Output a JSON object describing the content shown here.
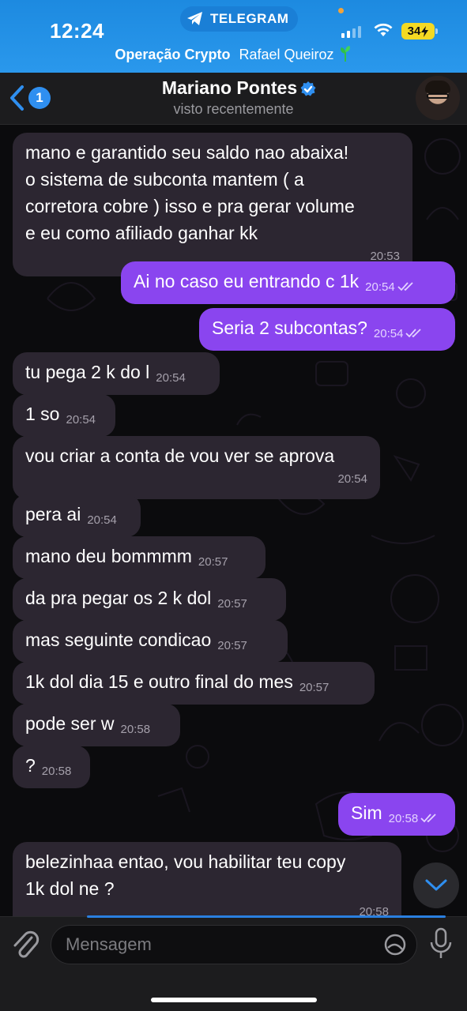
{
  "status_bar": {
    "time": "12:24",
    "app_pill_label": "TELEGRAM",
    "battery": "34",
    "battery_color": "#f4d923"
  },
  "chat_context": {
    "group": "Operação Crypto",
    "person": "Rafael Queiroz",
    "emoji_icon": "plant-icon"
  },
  "header": {
    "back_badge": "1",
    "contact_name": "Mariano Pontes",
    "verified_icon": "verified-badge-icon",
    "last_seen": "visto recentemente"
  },
  "messages": [
    {
      "dir": "in",
      "text": "mano e garantido seu saldo nao abaixa!\no sistema de subconta mantem ( a\ncorretora cobre ) isso e pra gerar volume\ne eu como afiliado ganhar kk",
      "time": "20:53"
    },
    {
      "dir": "out",
      "text": "Ai no caso eu entrando c 1k",
      "time": "20:54",
      "read": true
    },
    {
      "dir": "out",
      "text": "Seria 2 subcontas?",
      "time": "20:54",
      "read": true
    },
    {
      "dir": "in",
      "text": "tu pega 2 k do l",
      "time": "20:54"
    },
    {
      "dir": "in",
      "text": "1 so",
      "time": "20:54"
    },
    {
      "dir": "in",
      "text": "vou criar a conta de vou ver se aprova",
      "time": "20:54"
    },
    {
      "dir": "in",
      "text": "pera ai",
      "time": "20:54"
    },
    {
      "dir": "in",
      "text": "mano deu bommmm",
      "time": "20:57"
    },
    {
      "dir": "in",
      "text": "da pra pegar os 2 k dol",
      "time": "20:57"
    },
    {
      "dir": "in",
      "text": "mas seguinte condicao",
      "time": "20:57"
    },
    {
      "dir": "in",
      "text": "1k dol dia 15 e outro final do mes",
      "time": "20:57"
    },
    {
      "dir": "in",
      "text": "pode ser w",
      "time": "20:58"
    },
    {
      "dir": "in",
      "text": "?",
      "time": "20:58"
    },
    {
      "dir": "out",
      "text": "Sim",
      "time": "20:58",
      "read": true
    },
    {
      "dir": "in",
      "text": "belezinhaa entao, vou habilitar teu copy\n1k dol ne ?",
      "time": "20:58"
    }
  ],
  "composer": {
    "placeholder": "Mensagem"
  },
  "colors": {
    "outgoing_bubble": "#8a45ef",
    "incoming_bubble": "#2c2631",
    "accent": "#2f8ff0",
    "header_live_activity": "#1d8ae0"
  }
}
